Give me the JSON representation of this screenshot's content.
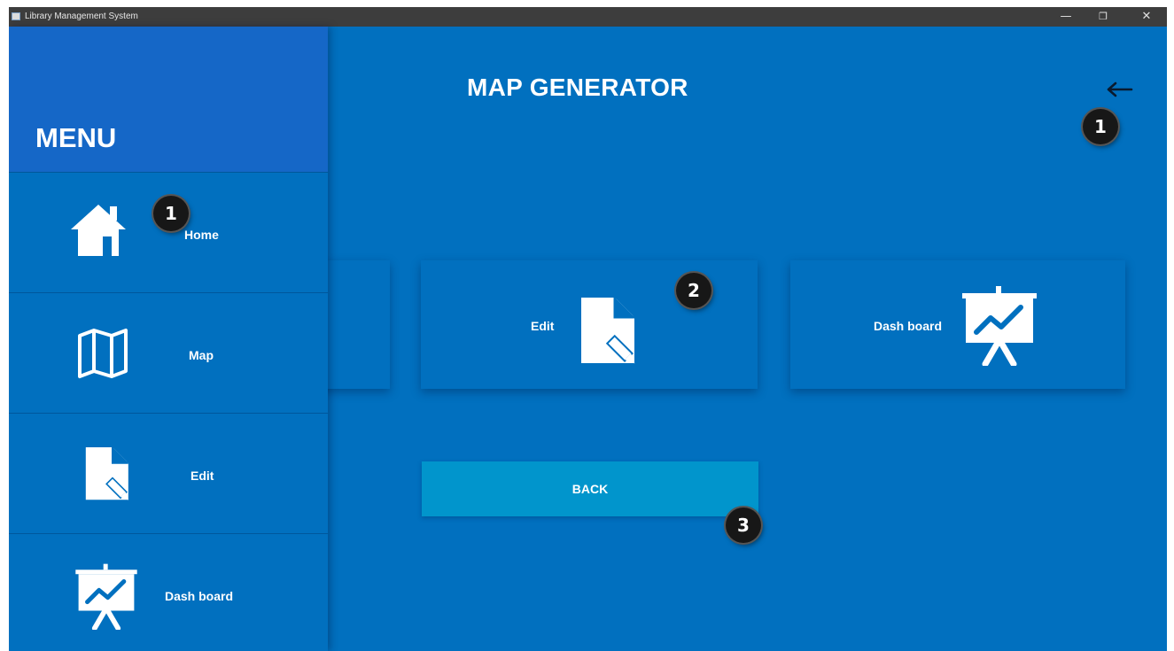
{
  "window": {
    "title": "Library Management System",
    "min_glyph": "—",
    "max_glyph": "❐",
    "close_glyph": "✕"
  },
  "main": {
    "title": "MAP GENERATOR",
    "back_arrow_icon": "arrow-left-icon",
    "cards": [
      {
        "label": "",
        "icon": "none"
      },
      {
        "label": "Edit",
        "icon": "document-edit-icon"
      },
      {
        "label": "Dash board",
        "icon": "presentation-chart-icon"
      }
    ],
    "back_button_label": "BACK"
  },
  "sidebar": {
    "menu_title": "MENU",
    "items": [
      {
        "label": "Home",
        "icon": "home-icon"
      },
      {
        "label": "Map",
        "icon": "map-icon"
      },
      {
        "label": "Edit",
        "icon": "document-edit-icon"
      },
      {
        "label": "Dash board",
        "icon": "presentation-chart-icon"
      }
    ]
  },
  "callouts": [
    "1",
    "1",
    "2",
    "3"
  ],
  "colors": {
    "background": "#0170bf",
    "menu_header": "#1567c7",
    "back_button": "#0195cc",
    "titlebar": "#3d3d3d",
    "callout": "#171717"
  }
}
